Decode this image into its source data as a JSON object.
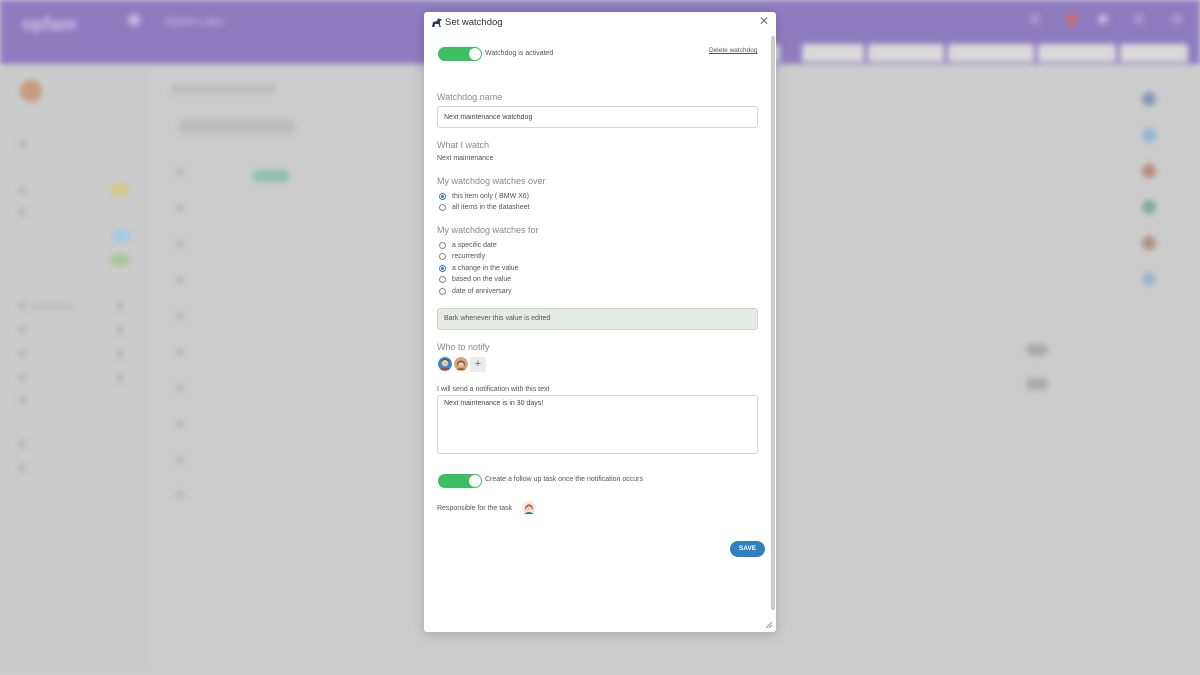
{
  "background": {
    "app_name": "opfam",
    "breadcrumb": "Option Labs"
  },
  "modal": {
    "title": "Set watchdog",
    "close_symbol": "✕",
    "activated_label": "Watchdog is activated",
    "activated": true,
    "delete_link": "Delete watchdog",
    "name_heading": "Watchdog name",
    "name_value": "Next maintenance watchdog",
    "what_heading": "What I watch",
    "what_value": "Next maintenance",
    "over_heading": "My watchdog watches over",
    "over_options": [
      {
        "label": "this item only ( BMW X6)",
        "checked": true
      },
      {
        "label": "all items in the datasheet",
        "checked": false
      }
    ],
    "for_heading": "My watchdog watches for",
    "for_options": [
      {
        "label": "a specific date",
        "checked": false
      },
      {
        "label": "recurrently",
        "checked": false
      },
      {
        "label": "a change in the value",
        "checked": true
      },
      {
        "label": "based on the value",
        "checked": false
      },
      {
        "label": "date of anniversary",
        "checked": false
      }
    ],
    "info_text": "Bark whenever this value is edited",
    "notify_heading": "Who to notify",
    "add_symbol": "+",
    "notification_label": "I will send a notification with this text",
    "notification_text": "Next maintenance is in 30 days!",
    "followup_label": "Create a follow up task once the notification occurs",
    "followup": true,
    "responsible_label": "Responsible for the task",
    "save_label": "SAVE"
  },
  "colors": {
    "toggle_on": "#3bbf62",
    "save_button": "#2f7fc1",
    "radio_checked": "#2f79e0",
    "header_bg": "#8e7cc0"
  }
}
